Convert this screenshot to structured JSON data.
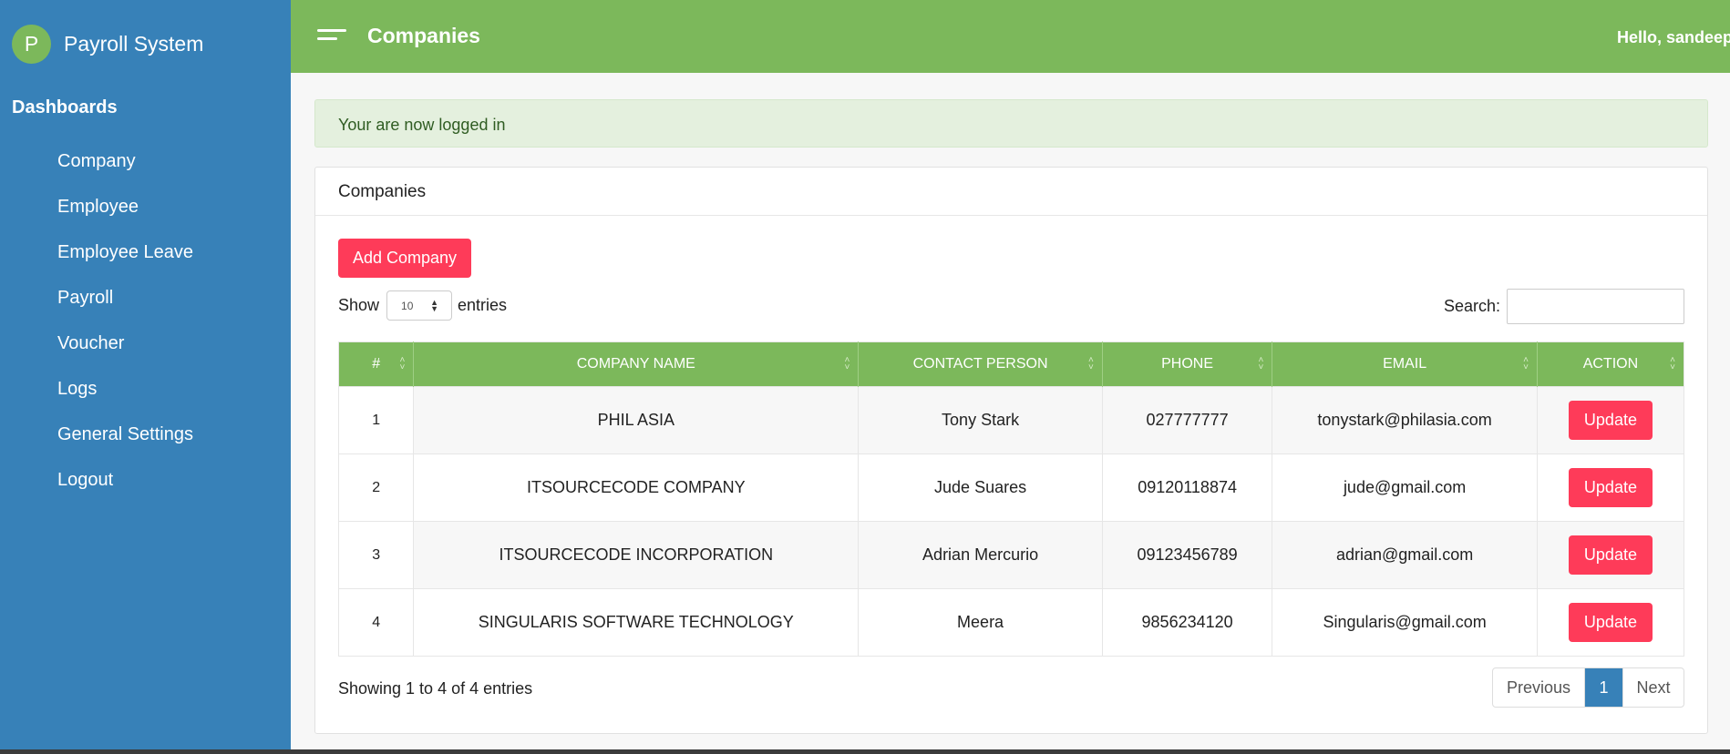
{
  "brand": {
    "logo_letter": "P",
    "title": "Payroll System"
  },
  "sidebar": {
    "heading": "Dashboards",
    "items": [
      {
        "label": "Company"
      },
      {
        "label": "Employee"
      },
      {
        "label": "Employee Leave"
      },
      {
        "label": "Payroll"
      },
      {
        "label": "Voucher"
      },
      {
        "label": "Logs"
      },
      {
        "label": "General Settings"
      },
      {
        "label": "Logout"
      }
    ]
  },
  "header": {
    "title": "Companies",
    "greeting": "Hello, sandeep!"
  },
  "alert": {
    "message": "Your are now logged in"
  },
  "panel": {
    "title": "Companies",
    "add_button": "Add Company",
    "length_label_before": "Show",
    "length_value": "10",
    "length_label_after": "entries",
    "search_label": "Search:",
    "search_value": ""
  },
  "table": {
    "columns": [
      "#",
      "COMPANY NAME",
      "CONTACT PERSON",
      "PHONE",
      "EMAIL",
      "ACTION"
    ],
    "rows": [
      {
        "num": "1",
        "company": "PHIL ASIA",
        "contact": "Tony Stark",
        "phone": "027777777",
        "email": "tonystark@philasia.com",
        "action": "Update"
      },
      {
        "num": "2",
        "company": "ITSOURCECODE COMPANY",
        "contact": "Jude Suares",
        "phone": "09120118874",
        "email": "jude@gmail.com",
        "action": "Update"
      },
      {
        "num": "3",
        "company": "ITSOURCECODE INCORPORATION",
        "contact": "Adrian Mercurio",
        "phone": "09123456789",
        "email": "adrian@gmail.com",
        "action": "Update"
      },
      {
        "num": "4",
        "company": "SINGULARIS SOFTWARE TECHNOLOGY",
        "contact": "Meera",
        "phone": "9856234120",
        "email": "Singularis@gmail.com",
        "action": "Update"
      }
    ]
  },
  "footer": {
    "info": "Showing 1 to 4 of 4 entries",
    "prev": "Previous",
    "current_page": "1",
    "next": "Next"
  },
  "colors": {
    "sidebar": "#3781b8",
    "header": "#7cb85b",
    "button": "#fe3b59",
    "alert_bg": "#e4f0de"
  }
}
